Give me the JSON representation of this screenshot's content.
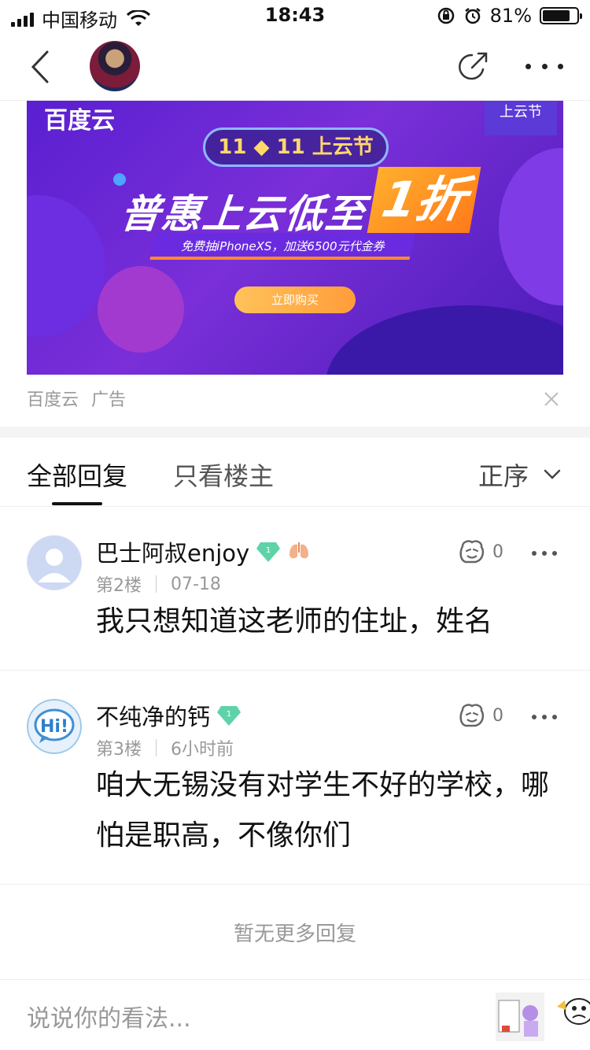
{
  "status_bar": {
    "carrier": "中国移动",
    "time": "18:43",
    "battery": "81%",
    "battery_level": 0.81
  },
  "nav": {
    "back_icon": "chevron-left-icon",
    "share_icon": "share-arrow-icon",
    "more_icon": "more-dots-icon"
  },
  "ad": {
    "banner": {
      "brand": "百度云",
      "tag": "上云节",
      "pill": "11 ◆ 11 上云节",
      "headline": "普惠上云低至",
      "headline_highlight": "1折",
      "subline": "免费抽iPhoneXS，加送6500元代金券",
      "cta": "立即购买"
    },
    "source": "百度云",
    "label": "广告"
  },
  "tabs": {
    "all": "全部回复",
    "op_only": "只看楼主",
    "sort": "正序"
  },
  "comments": [
    {
      "user": "巴士阿叔enjoy",
      "badge_level": "1",
      "floor": "第2楼",
      "time": "07-18",
      "text": "我只想知道这老师的住址，姓名",
      "likes": "0"
    },
    {
      "user": "不纯净的钙",
      "badge_level": "1",
      "floor": "第3楼",
      "time": "6小时前",
      "text": "咱大无锡没有对学生不好的学校，哪怕是职高，不像你们",
      "likes": "0",
      "avatar_text": "Hi!"
    }
  ],
  "no_more": "暂无更多回复",
  "composer": {
    "placeholder": "说说你的看法..."
  },
  "colors": {
    "gem": "#5fd3a8",
    "banner_start": "#5a1fd1",
    "banner_accent": "#ff8a2a"
  }
}
